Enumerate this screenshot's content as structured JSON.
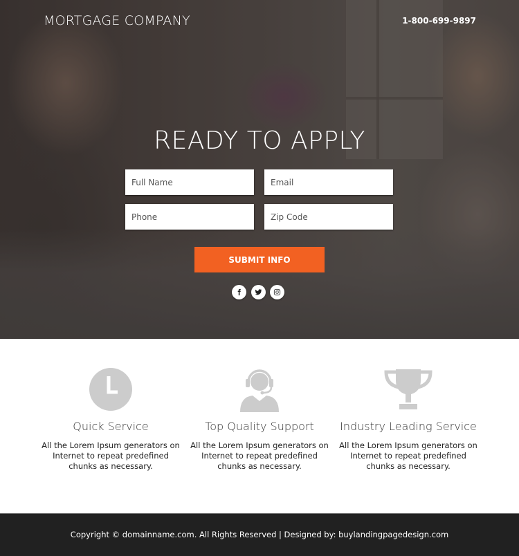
{
  "header": {
    "brand": "MORTGAGE COMPANY",
    "phone": "1-800-699-9897"
  },
  "hero": {
    "title": "READY TO APPLY",
    "form": {
      "full_name_placeholder": "Full Name",
      "email_placeholder": "Email",
      "phone_placeholder": "Phone",
      "zip_placeholder": "Zip Code",
      "submit_label": "SUBMIT INFO"
    },
    "social": [
      {
        "name": "facebook-icon"
      },
      {
        "name": "twitter-icon"
      },
      {
        "name": "instagram-icon"
      }
    ]
  },
  "features": [
    {
      "icon": "clock-icon",
      "title": "Quick Service",
      "description": "All the Lorem Ipsum generators on Internet to repeat predefined chunks as necessary."
    },
    {
      "icon": "headset-support-icon",
      "title": "Top Quality Support",
      "description": "All the Lorem Ipsum generators on Internet to repeat predefined chunks as necessary."
    },
    {
      "icon": "trophy-icon",
      "title": "Industry Leading Service",
      "description": "All the Lorem Ipsum generators on Internet to repeat predefined chunks as necessary."
    }
  ],
  "footer": {
    "text": "Copyright © domainname.com. All Rights Reserved | Designed by: buylandingpagedesign.com"
  },
  "colors": {
    "accent": "#f26122",
    "icon_gray": "#cccccc",
    "footer_bg": "#212121"
  }
}
